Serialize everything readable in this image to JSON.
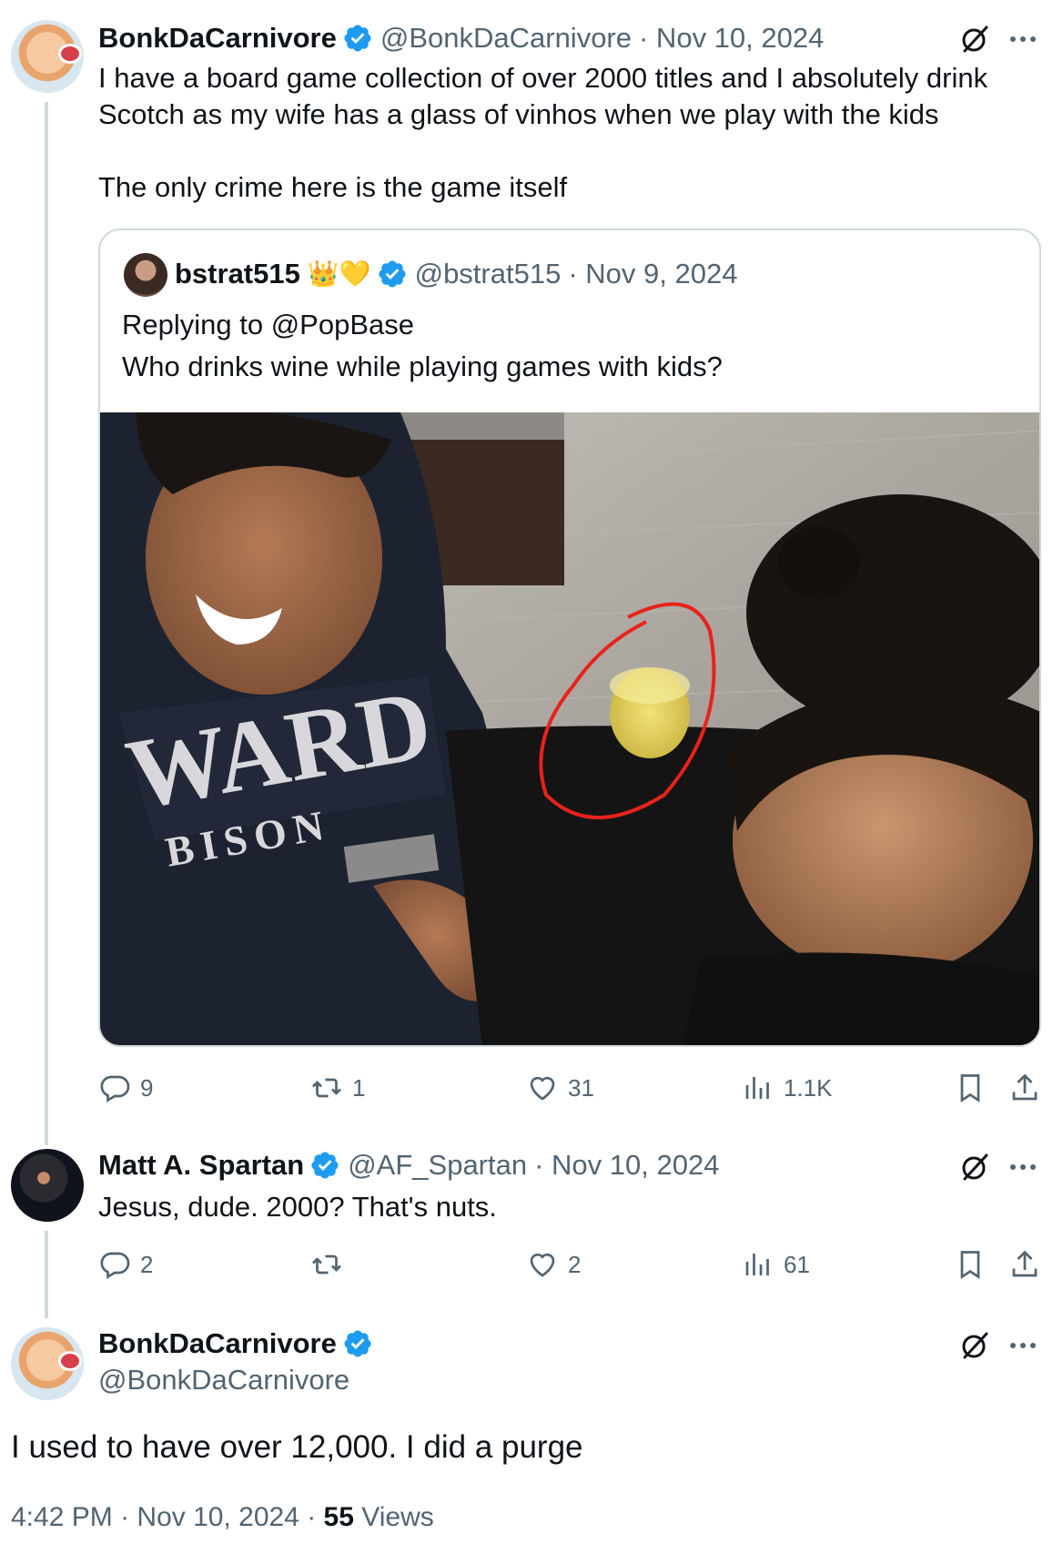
{
  "tweet1": {
    "name": "BonkDaCarnivore",
    "handle": "@BonkDaCarnivore",
    "date": "· Nov 10, 2024",
    "text_line1": "I have a board game collection of over 2000 titles and I absolutely drink",
    "text_line2": "Scotch as my wife has a glass of vinhos when we play with the kids",
    "text_line3": "The only crime here is the game itself",
    "quote": {
      "name": "bstrat515",
      "emoji": "👑💛",
      "handle": "@bstrat515",
      "date": "· Nov 9, 2024",
      "replying_to": "Replying to @PopBase",
      "text": "Who drinks wine while playing games with kids?",
      "image_sweatshirt_text1": "WARD",
      "image_sweatshirt_text2": "BISON"
    },
    "replies": "9",
    "reposts": "1",
    "likes": "31",
    "views": "1.1K"
  },
  "tweet2": {
    "name": "Matt A. Spartan",
    "handle": "@AF_Spartan",
    "date": "· Nov 10, 2024",
    "text": "Jesus, dude. 2000? That's nuts.",
    "replies": "2",
    "reposts": "",
    "likes": "2",
    "views": "61"
  },
  "tweet3": {
    "name": "BonkDaCarnivore",
    "handle": "@BonkDaCarnivore",
    "text": "I used to have over 12,000. I did a purge",
    "time": "4:42 PM",
    "date": "Nov 10, 2024",
    "views_count": "55",
    "views_label": "Views"
  },
  "icons": {
    "verified": "verified-badge-icon",
    "grok": "grok-icon",
    "more": "more-icon",
    "reply": "reply-icon",
    "repost": "repost-icon",
    "like": "like-icon",
    "views": "views-icon",
    "bookmark": "bookmark-icon",
    "share": "share-icon"
  },
  "colors": {
    "verified": "#1d9bf0",
    "muted": "#536471",
    "border": "#cfd9de",
    "circle_annotation": "#e8221b"
  }
}
